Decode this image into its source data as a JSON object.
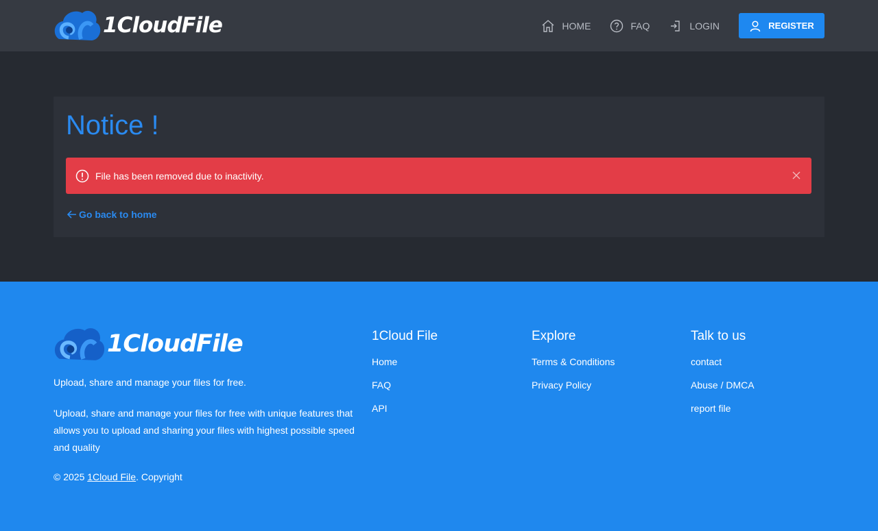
{
  "header": {
    "brand": "1CloudFile",
    "nav": {
      "home": "HOME",
      "faq": "FAQ",
      "login": "LOGIN",
      "register": "REGISTER"
    }
  },
  "notice": {
    "title": "Notice !",
    "alert_message": "File has been removed due to inactivity.",
    "back_link": "Go back to home"
  },
  "footer": {
    "brand": "1CloudFile",
    "tagline": "Upload, share and manage your files for free.",
    "description": "'Upload, share and manage your files for free with unique features that allows you to upload and sharing your files with highest possible speed and quality",
    "copyright_prefix": "© 2025 ",
    "copyright_link": "1Cloud File",
    "copyright_suffix": ". Copyright",
    "columns": [
      {
        "heading": "1Cloud File",
        "links": [
          "Home",
          "FAQ",
          "API"
        ]
      },
      {
        "heading": "Explore",
        "links": [
          "Terms & Conditions",
          "Privacy Policy"
        ]
      },
      {
        "heading": "Talk to us",
        "links": [
          "contact",
          "Abuse / DMCA",
          "report file"
        ]
      }
    ]
  },
  "colors": {
    "header_bg": "#363a42",
    "page_bg": "#262a31",
    "card_bg": "#2d3139",
    "accent": "#1e88f0",
    "alert_bg": "#e33d47",
    "footer_bg": "#1f88ee"
  },
  "icons": {
    "logo": "cloud-swirl-icon",
    "home": "home-icon",
    "faq": "question-circle-icon",
    "login": "login-arrow-icon",
    "register": "user-icon",
    "alert": "exclamation-circle-icon",
    "close": "close-icon",
    "back": "arrow-left-icon"
  }
}
